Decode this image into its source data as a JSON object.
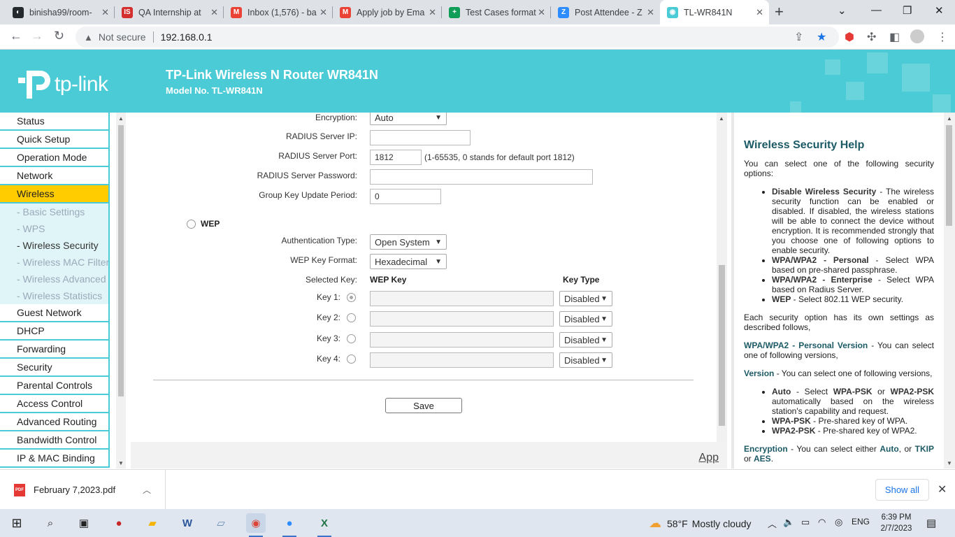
{
  "browser": {
    "tabs": [
      {
        "title": "binisha99/room-",
        "icon": "github-icon",
        "color": "#24292e"
      },
      {
        "title": "QA Internship at",
        "icon": "is-icon",
        "color": "#d32f2f"
      },
      {
        "title": "Inbox (1,576) - ba",
        "icon": "gmail-icon",
        "color": "#ea4335"
      },
      {
        "title": "Apply job by Ema",
        "icon": "gmail-icon",
        "color": "#ea4335"
      },
      {
        "title": "Test Cases format",
        "icon": "sheets-icon",
        "color": "#0f9d58"
      },
      {
        "title": "Post Attendee - Z",
        "icon": "zoom-icon",
        "color": "#2d8cff"
      },
      {
        "title": "TL-WR841N",
        "icon": "tplink-icon",
        "color": "#4acbd6"
      }
    ],
    "security_label": "Not secure",
    "url": "192.168.0.1"
  },
  "router": {
    "logo": "tp-link",
    "title": "TP-Link Wireless N Router WR841N",
    "model": "Model No. TL-WR841N"
  },
  "menu": {
    "items": [
      {
        "label": "Status"
      },
      {
        "label": "Quick Setup"
      },
      {
        "label": "Operation Mode"
      },
      {
        "label": "Network"
      },
      {
        "label": "Wireless",
        "active": true
      }
    ],
    "subitems": [
      {
        "label": "- Basic Settings"
      },
      {
        "label": "- WPS"
      },
      {
        "label": "- Wireless Security",
        "current": true
      },
      {
        "label": "- Wireless MAC Filtering"
      },
      {
        "label": "- Wireless Advanced"
      },
      {
        "label": "- Wireless Statistics"
      }
    ],
    "items_after": [
      {
        "label": "Guest Network"
      },
      {
        "label": "DHCP"
      },
      {
        "label": "Forwarding"
      },
      {
        "label": "Security"
      },
      {
        "label": "Parental Controls"
      },
      {
        "label": "Access Control"
      },
      {
        "label": "Advanced Routing"
      },
      {
        "label": "Bandwidth Control"
      },
      {
        "label": "IP & MAC Binding"
      }
    ]
  },
  "form": {
    "encryption_label": "Encryption:",
    "encryption_value": "Auto",
    "radius_ip_label": "RADIUS Server IP:",
    "radius_ip_value": "",
    "radius_port_label": "RADIUS Server Port:",
    "radius_port_value": "1812",
    "radius_port_hint": "(1-65535, 0 stands for default port 1812)",
    "radius_pw_label": "RADIUS Server Password:",
    "radius_pw_value": "",
    "group_key_label": "Group Key Update Period:",
    "group_key_value": "0",
    "wep_label": "WEP",
    "auth_type_label": "Authentication Type:",
    "auth_type_value": "Open System",
    "key_format_label": "WEP Key Format:",
    "key_format_value": "Hexadecimal",
    "selected_key_label": "Selected Key:",
    "wep_key_header": "WEP Key",
    "key_type_header": "Key Type",
    "keys": [
      {
        "label": "Key 1:",
        "value": "",
        "type": "Disabled",
        "selected": true
      },
      {
        "label": "Key 2:",
        "value": "",
        "type": "Disabled",
        "selected": false
      },
      {
        "label": "Key 3:",
        "value": "",
        "type": "Disabled",
        "selected": false
      },
      {
        "label": "Key 4:",
        "value": "",
        "type": "Disabled",
        "selected": false
      }
    ],
    "save_label": "Save",
    "app_link": "App"
  },
  "help": {
    "title": "Wireless Security Help",
    "intro": "You can select one of the following security options:",
    "options": [
      {
        "term": "Disable Wireless Security",
        "text": " - The wireless security function can be enabled or disabled. If disabled, the wireless stations will be able to connect the device without encryption. It is recommended strongly that you choose one of following options to enable security."
      },
      {
        "term": "WPA/WPA2 - Personal",
        "text": " - Select WPA based on pre-shared passphrase."
      },
      {
        "term": "WPA/WPA2 - Enterprise",
        "text": " - Select WPA based on Radius Server."
      },
      {
        "term": "WEP",
        "text": " - Select 802.11 WEP security."
      }
    ],
    "each_option": "Each security option has its own settings as described follows,",
    "personal_term": "WPA/WPA2 - Personal Version",
    "personal_text": " -  You can select one of following versions,",
    "version_term": "Version",
    "version_text": " -  You can select one of following versions,",
    "versions": [
      {
        "term": "Auto",
        "text": " - Select ",
        "t2": "WPA-PSK",
        "mid": " or ",
        "t3": "WPA2-PSK",
        "rest": " automatically based on the wireless station's capability and request."
      },
      {
        "term": "WPA-PSK",
        "text": " - Pre-shared key of WPA."
      },
      {
        "term": "WPA2-PSK",
        "text": " - Pre-shared key of WPA2."
      }
    ],
    "encryption_term": "Encryption",
    "encryption_text": " - You can select either ",
    "enc_auto": "Auto",
    "enc_or": ", or ",
    "enc_tkip": "TKIP",
    "enc_or2": " or ",
    "enc_aes": "AES",
    "enc_end": "."
  },
  "downloads": {
    "file": "February 7,2023.pdf",
    "file_icon_text": "PDF",
    "show_all": "Show all"
  },
  "taskbar": {
    "weather_temp": "58°F",
    "weather_desc": "Mostly cloudy",
    "lang": "ENG",
    "time": "6:39 PM",
    "date": "2/7/2023"
  },
  "colors": {
    "brand": "#4acbd6",
    "menu_active": "#ffcc00",
    "help_heading": "#1c5a66"
  }
}
